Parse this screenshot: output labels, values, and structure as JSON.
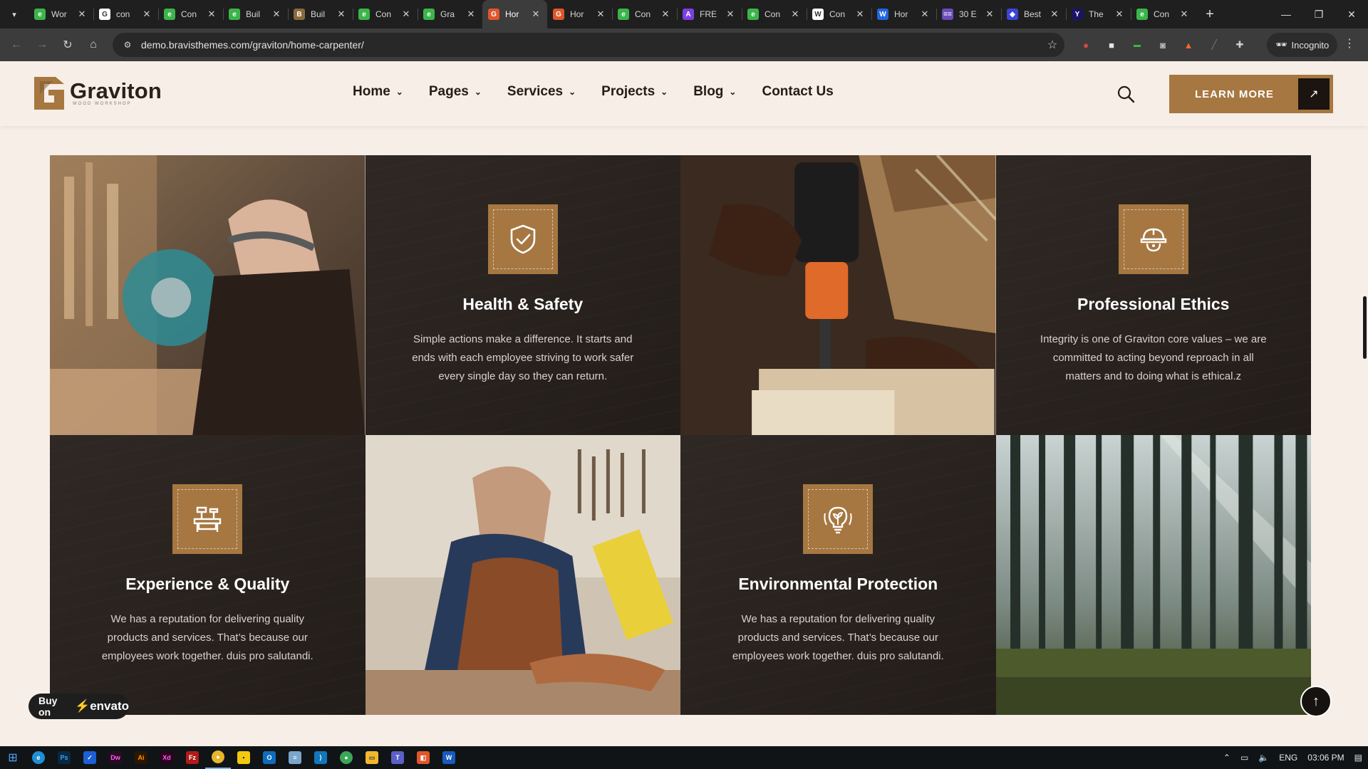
{
  "browser": {
    "tabs": [
      {
        "title": "Wor",
        "fav_color": "#3bb54a",
        "fav_glyph": "e"
      },
      {
        "title": "con",
        "fav_color": "#ffffff",
        "fav_glyph": "G"
      },
      {
        "title": "Con",
        "fav_color": "#3bb54a",
        "fav_glyph": "e"
      },
      {
        "title": "Buil",
        "fav_color": "#3bb54a",
        "fav_glyph": "e"
      },
      {
        "title": "Buil",
        "fav_color": "#8a6a3a",
        "fav_glyph": "B"
      },
      {
        "title": "Con",
        "fav_color": "#3bb54a",
        "fav_glyph": "e"
      },
      {
        "title": "Gra",
        "fav_color": "#3bb54a",
        "fav_glyph": "e"
      },
      {
        "title": "Hor",
        "fav_color": "#e0562b",
        "fav_glyph": "G"
      },
      {
        "title": "Hor",
        "fav_color": "#e0562b",
        "fav_glyph": "G"
      },
      {
        "title": "Con",
        "fav_color": "#3bb54a",
        "fav_glyph": "e"
      },
      {
        "title": "FRE",
        "fav_color": "#7b3fe4",
        "fav_glyph": "A"
      },
      {
        "title": "Con",
        "fav_color": "#3bb54a",
        "fav_glyph": "e"
      },
      {
        "title": "Con",
        "fav_color": "#ffffff",
        "fav_glyph": "W"
      },
      {
        "title": "Hor",
        "fav_color": "#2266dd",
        "fav_glyph": "W"
      },
      {
        "title": "30 E",
        "fav_color": "#6a4bb8",
        "fav_glyph": "=="
      },
      {
        "title": "Best",
        "fav_color": "#3b45d6",
        "fav_glyph": "◆"
      },
      {
        "title": "The",
        "fav_color": "#1b1464",
        "fav_glyph": "Y"
      },
      {
        "title": "Con",
        "fav_color": "#3bb54a",
        "fav_glyph": "e"
      }
    ],
    "active_tab_index": 7,
    "url": "demo.bravisthemes.com/graviton/home-carpenter/",
    "incognito_label": "Incognito"
  },
  "site": {
    "logo_name": "Graviton",
    "logo_tagline": "WOOD WORKSHOP",
    "brand_color": "#a67741",
    "menu": [
      {
        "label": "Home",
        "has_dropdown": true
      },
      {
        "label": "Pages",
        "has_dropdown": true
      },
      {
        "label": "Services",
        "has_dropdown": true
      },
      {
        "label": "Projects",
        "has_dropdown": true
      },
      {
        "label": "Blog",
        "has_dropdown": true
      },
      {
        "label": "Contact Us",
        "has_dropdown": false
      }
    ],
    "cta_label": "LEARN MORE"
  },
  "features": [
    {
      "title": "Health & Safety",
      "icon": "shield-check-icon",
      "text": "Simple actions make a difference. It starts and ends with each employee striving to work safer every single day so they can return."
    },
    {
      "title": "Professional Ethics",
      "icon": "hard-hat-worker-icon",
      "text": "Integrity is one of Graviton core values – we are committed to acting beyond reproach in all matters and to doing what is ethical.z"
    },
    {
      "title": "Experience & Quality",
      "icon": "workbench-tools-icon",
      "text": "We has a reputation for delivering quality products and services. That’s because our employees work together. duis pro salutandi."
    },
    {
      "title": "Environmental Protection",
      "icon": "eco-lightbulb-icon",
      "text": "We has a reputation for delivering quality products and services. That’s because our employees work together. duis pro salutandi."
    }
  ],
  "photos": [
    {
      "name": "photo-carpenter-miter-saw"
    },
    {
      "name": "photo-hands-power-drill"
    },
    {
      "name": "photo-carpenter-chisel-workshop"
    },
    {
      "name": "photo-forest-trees"
    }
  ],
  "envato_badge": {
    "prefix": "Buy on",
    "brand": "envato"
  },
  "taskbar": {
    "language": "ENG",
    "time": "03:06 PM"
  }
}
